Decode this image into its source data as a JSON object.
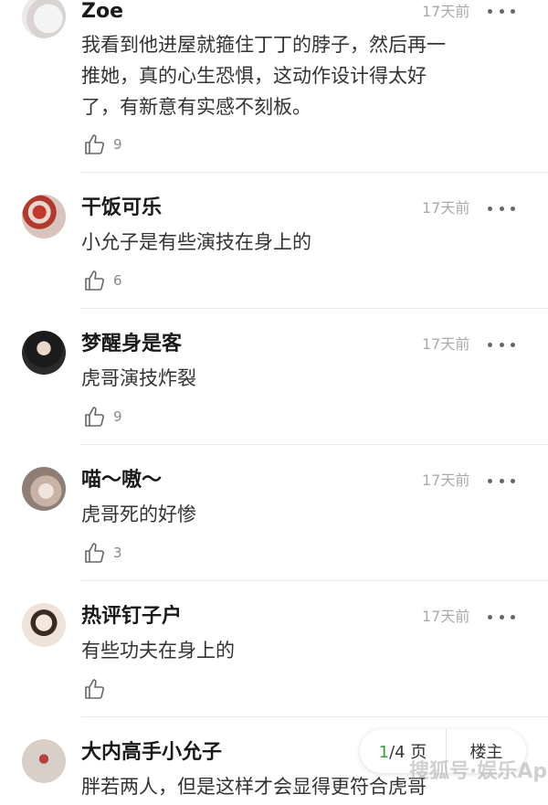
{
  "comments": [
    {
      "name": "Zoe",
      "time": "17天前",
      "lines": [
        "我看到他进屋就箍住丁丁的脖子，然后再一",
        "推她，真的心生恐惧，这动作设计得太好",
        "了，有新意有实感不刻板。"
      ],
      "likes": "9"
    },
    {
      "name": "干饭可乐",
      "time": "17天前",
      "lines": [
        "小允子是有些演技在身上的"
      ],
      "likes": "6"
    },
    {
      "name": "梦醒身是客",
      "time": "17天前",
      "lines": [
        "虎哥演技炸裂"
      ],
      "likes": "9"
    },
    {
      "name": "喵～嗷～",
      "time": "17天前",
      "lines": [
        "虎哥死的好惨"
      ],
      "likes": "3"
    },
    {
      "name": "热评钉子户",
      "time": "17天前",
      "lines": [
        "有些功夫在身上的"
      ],
      "likes": ""
    },
    {
      "name": "大内高手小允子",
      "time": "",
      "lines": [
        "胖若两人，但是这样才会显得更符合虎哥"
      ],
      "likes": ""
    }
  ],
  "pager": {
    "current": "1",
    "total_suffix": "/4 页",
    "host_label": "楼主"
  },
  "watermark": "搜狐号·娱乐App",
  "colors": {
    "accent_green": "#3a9c3a",
    "time_gray": "#aaaaaa"
  }
}
